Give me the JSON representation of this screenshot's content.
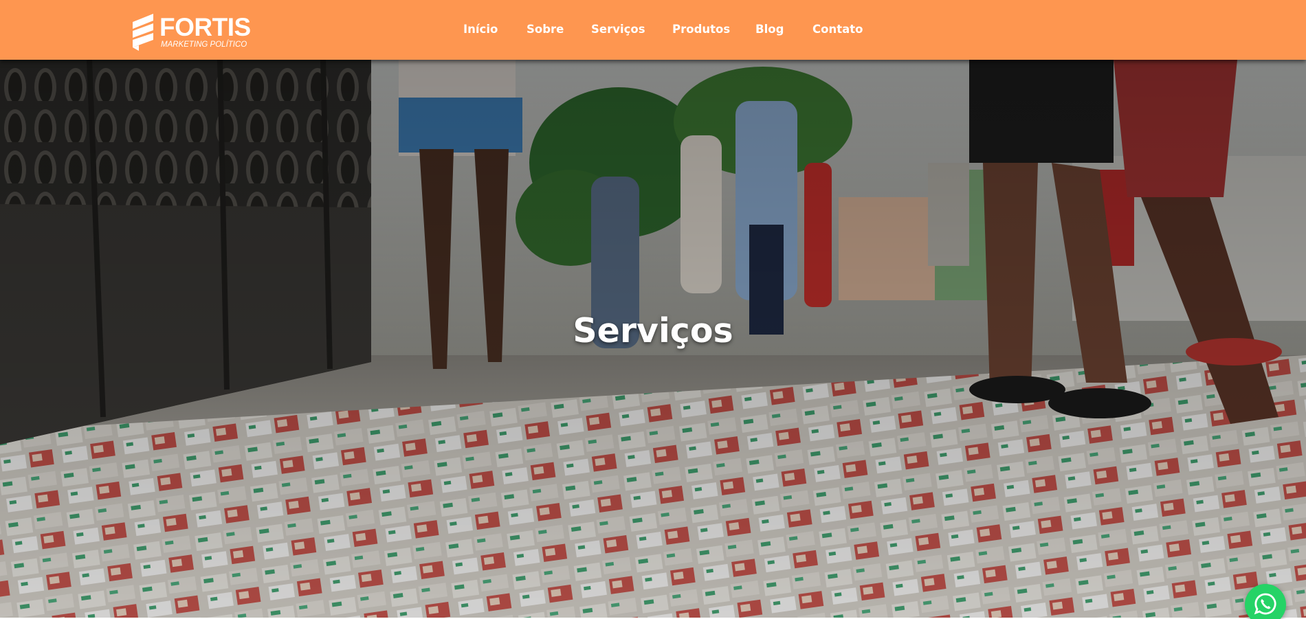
{
  "brand": {
    "name": "FORTIS",
    "tagline": "MARKETING POLÍTICO",
    "logo_icon": "stacked-flag-logo-icon",
    "header_color": "#fe9650"
  },
  "nav": {
    "items": [
      {
        "label": "Início"
      },
      {
        "label": "Sobre"
      },
      {
        "label": "Serviços"
      },
      {
        "label": "Produtos"
      },
      {
        "label": "Blog"
      },
      {
        "label": "Contato"
      }
    ]
  },
  "hero": {
    "title": "Serviços",
    "background_description_icon": "street-campaign-flyers-photo"
  },
  "floating": {
    "whatsapp_icon": "whatsapp-icon",
    "whatsapp_color": "#25d366"
  }
}
